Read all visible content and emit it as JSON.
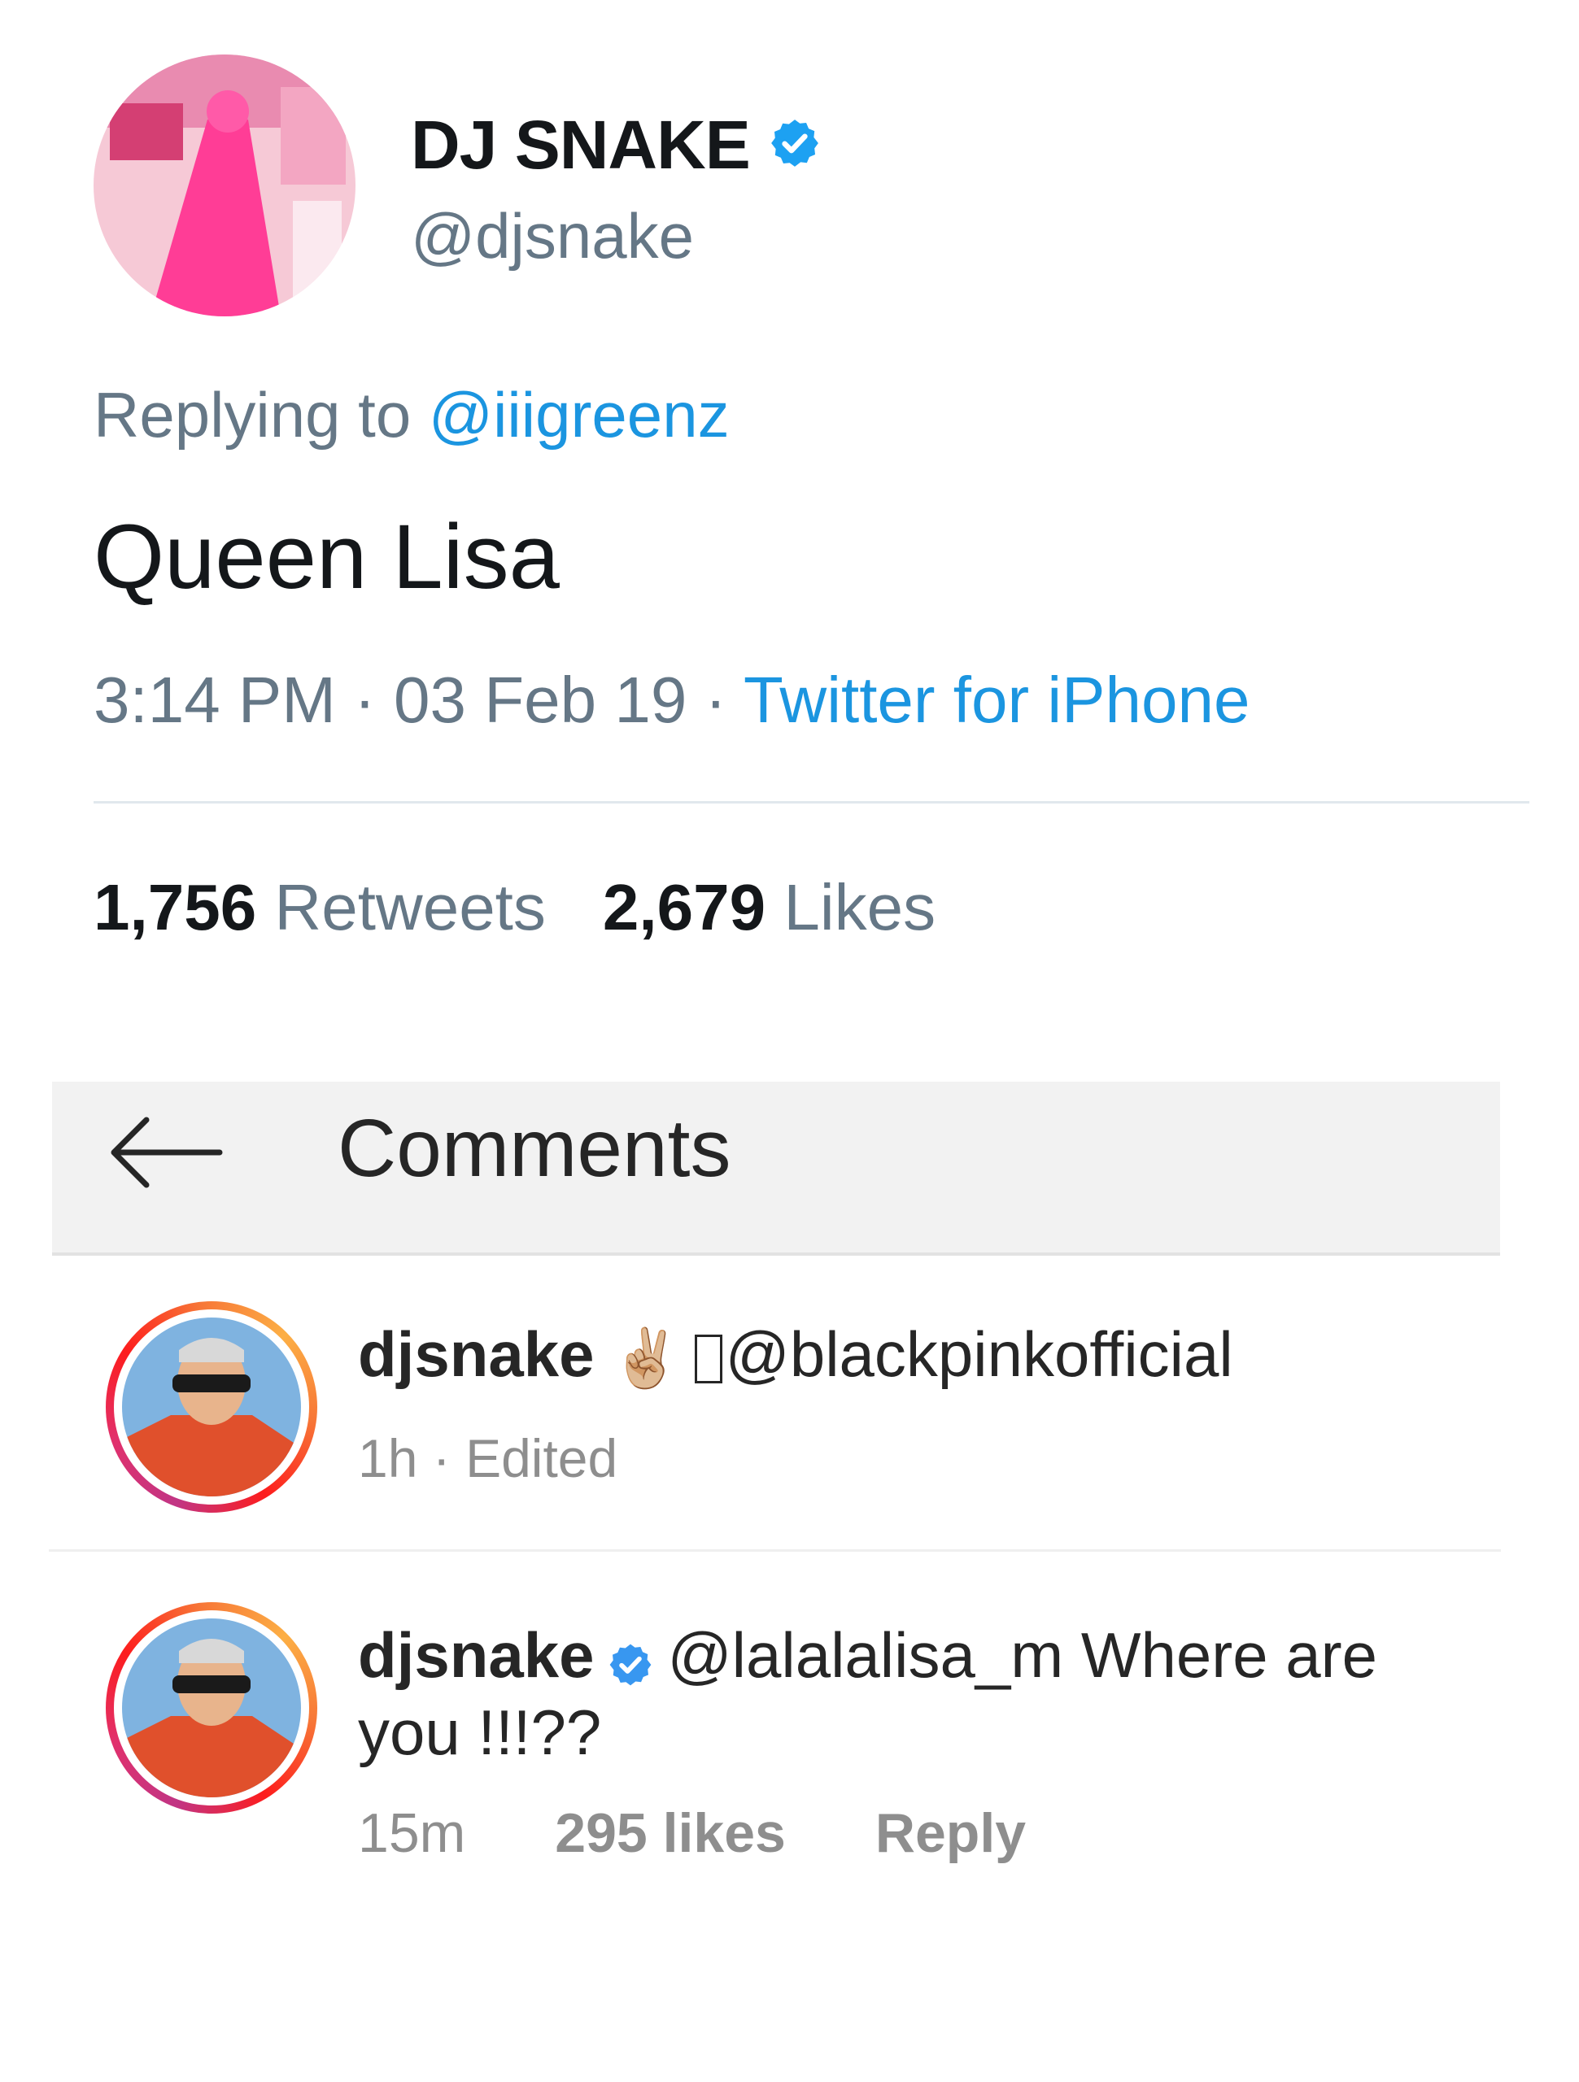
{
  "tweet": {
    "display_name": "DJ SNAKE",
    "handle": "@djsnake",
    "replying_prefix": "Replying to ",
    "replying_handle": "@iiigreenz",
    "text": "Queen Lisa",
    "time": "3:14 PM",
    "sep1": " · ",
    "date": "03 Feb 19",
    "sep2": " · ",
    "source": "Twitter for iPhone",
    "retweets_count": "1,756",
    "retweets_label": " Retweets",
    "likes_count": "2,679",
    "likes_label": " Likes"
  },
  "comments_header": {
    "title": "Comments"
  },
  "comments": [
    {
      "username": "djsnake",
      "emoji": "✌🏼",
      "text": "@blackpinkofficial",
      "meta": "1h · Edited"
    },
    {
      "username": "djsnake",
      "text_line1": "@lalalalisa_m Where are",
      "text_line2": "you !!!??",
      "time": "15m",
      "likes": "295 likes",
      "reply": "Reply"
    }
  ],
  "colors": {
    "twitter_blue": "#1b95e0",
    "muted_gray": "#657786",
    "ig_gray": "#8e8e8e"
  }
}
